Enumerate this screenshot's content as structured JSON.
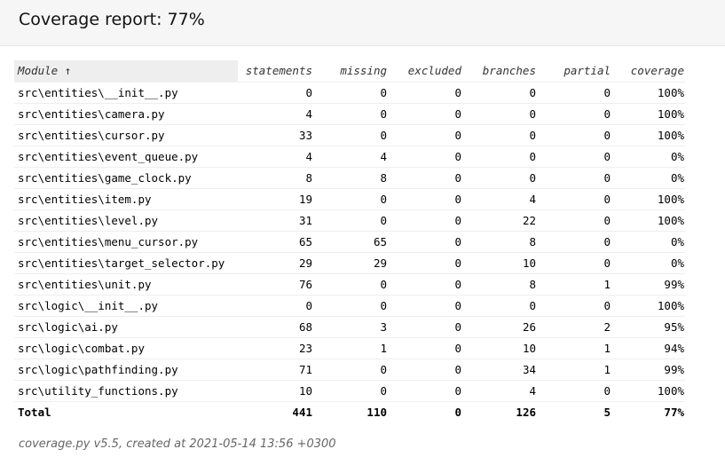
{
  "header": {
    "title": "Coverage report: 77%"
  },
  "table": {
    "columns": [
      "Module ↑",
      "statements",
      "missing",
      "excluded",
      "branches",
      "partial",
      "coverage"
    ],
    "rows": [
      [
        "src\\entities\\__init__.py",
        "0",
        "0",
        "0",
        "0",
        "0",
        "100%"
      ],
      [
        "src\\entities\\camera.py",
        "4",
        "0",
        "0",
        "0",
        "0",
        "100%"
      ],
      [
        "src\\entities\\cursor.py",
        "33",
        "0",
        "0",
        "0",
        "0",
        "100%"
      ],
      [
        "src\\entities\\event_queue.py",
        "4",
        "4",
        "0",
        "0",
        "0",
        "0%"
      ],
      [
        "src\\entities\\game_clock.py",
        "8",
        "8",
        "0",
        "0",
        "0",
        "0%"
      ],
      [
        "src\\entities\\item.py",
        "19",
        "0",
        "0",
        "4",
        "0",
        "100%"
      ],
      [
        "src\\entities\\level.py",
        "31",
        "0",
        "0",
        "22",
        "0",
        "100%"
      ],
      [
        "src\\entities\\menu_cursor.py",
        "65",
        "65",
        "0",
        "8",
        "0",
        "0%"
      ],
      [
        "src\\entities\\target_selector.py",
        "29",
        "29",
        "0",
        "10",
        "0",
        "0%"
      ],
      [
        "src\\entities\\unit.py",
        "76",
        "0",
        "0",
        "8",
        "1",
        "99%"
      ],
      [
        "src\\logic\\__init__.py",
        "0",
        "0",
        "0",
        "0",
        "0",
        "100%"
      ],
      [
        "src\\logic\\ai.py",
        "68",
        "3",
        "0",
        "26",
        "2",
        "95%"
      ],
      [
        "src\\logic\\combat.py",
        "23",
        "1",
        "0",
        "10",
        "1",
        "94%"
      ],
      [
        "src\\logic\\pathfinding.py",
        "71",
        "0",
        "0",
        "34",
        "1",
        "99%"
      ],
      [
        "src\\utility_functions.py",
        "10",
        "0",
        "0",
        "4",
        "0",
        "100%"
      ]
    ],
    "total": [
      "Total",
      "441",
      "110",
      "0",
      "126",
      "5",
      "77%"
    ]
  },
  "footer": {
    "text": "coverage.py v5.5, created at 2021-05-14 13:56 +0300"
  }
}
